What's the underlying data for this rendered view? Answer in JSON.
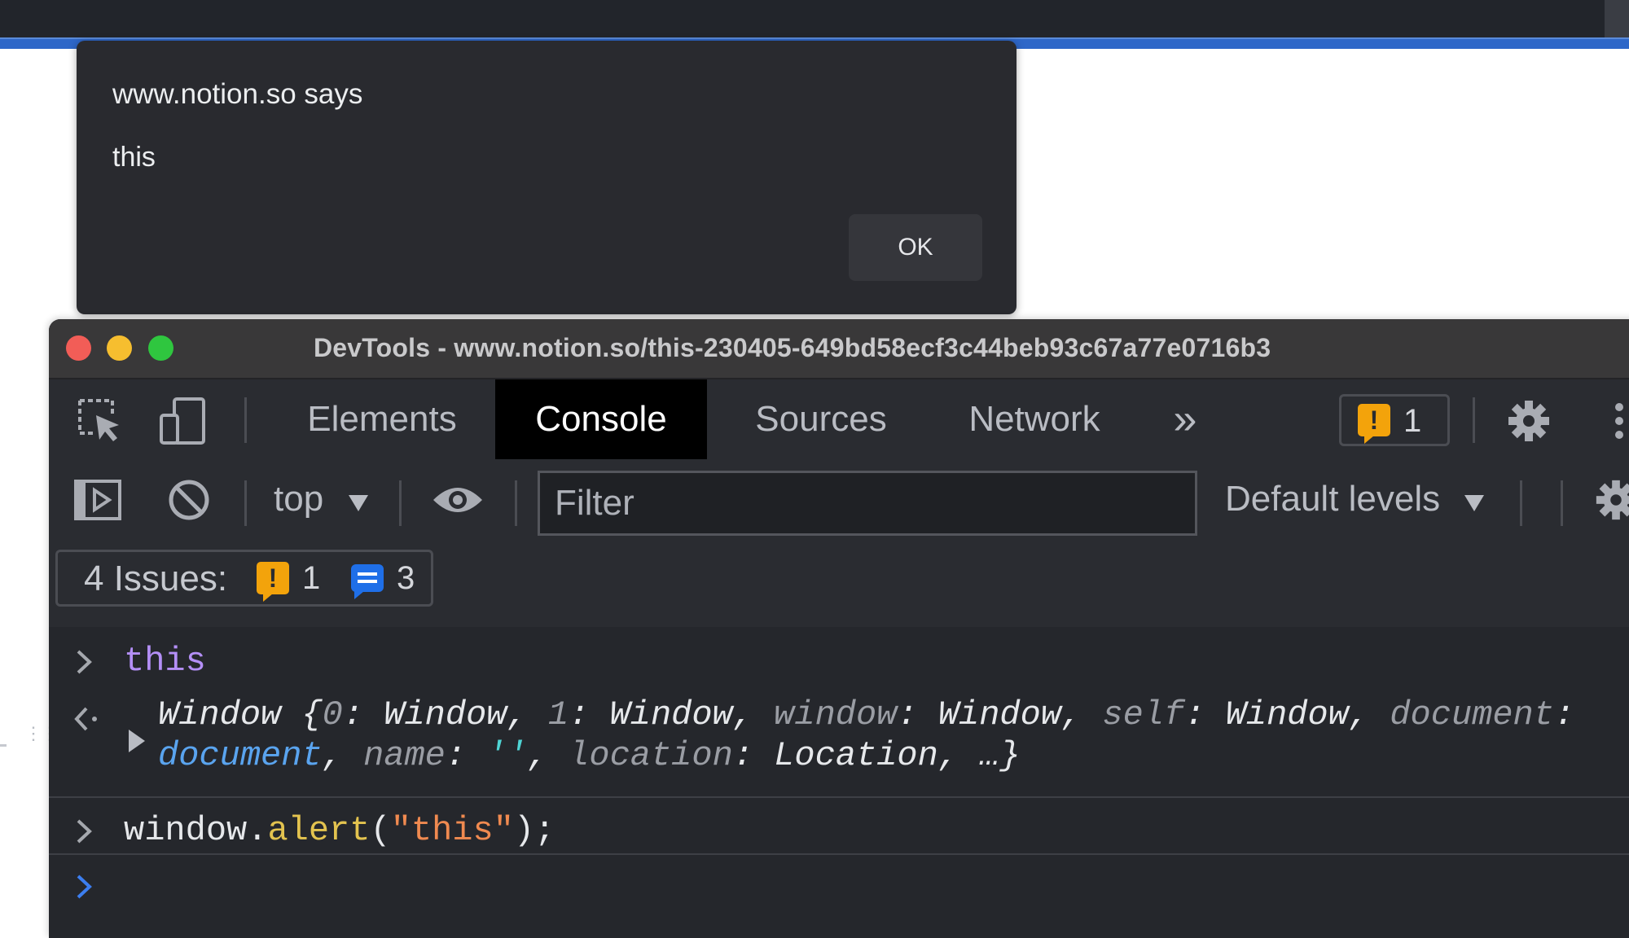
{
  "alert": {
    "title": "www.notion.so says",
    "message": "this",
    "ok_label": "OK"
  },
  "devtools": {
    "window_title": "DevTools - www.notion.so/this-230405-649bd58ecf3c44beb93c67a77e0716b3",
    "tabs": [
      {
        "label": "Elements"
      },
      {
        "label": "Console"
      },
      {
        "label": "Sources"
      },
      {
        "label": "Network"
      }
    ],
    "more_tabs_label": "»",
    "issue_count": "1",
    "toolbar": {
      "context": "top",
      "filter_placeholder": "Filter",
      "levels": "Default levels"
    },
    "issues_bar": {
      "label": "4 Issues:",
      "warning_count": "1",
      "info_count": "3"
    },
    "console": {
      "entry1_input": "this",
      "entry1_output": {
        "p1": "Window {",
        "k0": "0",
        "v0": ": Window, ",
        "k1": "1",
        "v1": ": Window, ",
        "k2": "window",
        "v2": ": Window, ",
        "k3": "self",
        "v3": ": Window, ",
        "k4": "document",
        "v4": ":",
        "l2a": "document",
        "l2b": ", ",
        "k5": "name",
        "v5": ": ",
        "v5s": "''",
        "v5e": ", ",
        "k6": "location",
        "v6": ": Location, …}"
      },
      "entry2_input": {
        "obj": "window.",
        "fn": "alert",
        "open": "(",
        "str": "\"this\"",
        "close": ");"
      }
    }
  },
  "colors": {
    "accent_blue": "#2e67c8",
    "warning": "#f3a30b",
    "info": "#1f6fe8"
  }
}
